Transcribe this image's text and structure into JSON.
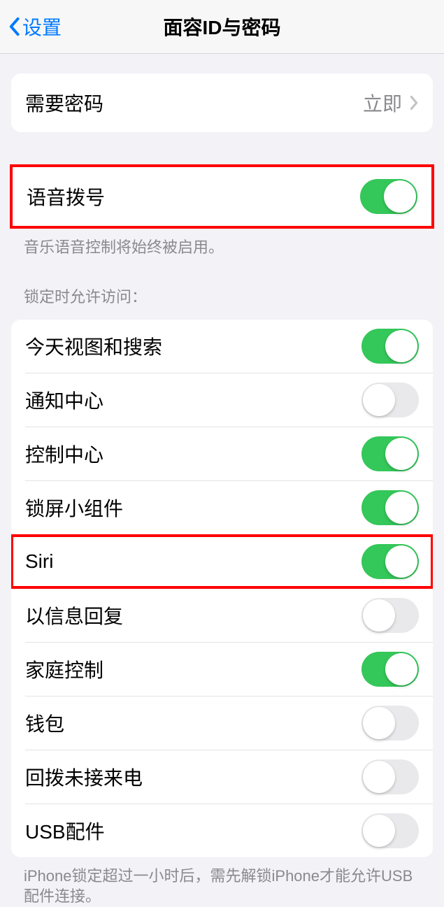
{
  "nav": {
    "back_label": "设置",
    "title": "面容ID与密码"
  },
  "passcode": {
    "label": "需要密码",
    "value": "立即"
  },
  "voice_dial": {
    "label": "语音拨号",
    "on": true,
    "footer": "音乐语音控制将始终被启用。"
  },
  "lock_access": {
    "header": "锁定时允许访问：",
    "items": [
      {
        "label": "今天视图和搜索",
        "on": true,
        "highlighted": false
      },
      {
        "label": "通知中心",
        "on": false,
        "highlighted": false
      },
      {
        "label": "控制中心",
        "on": true,
        "highlighted": false
      },
      {
        "label": "锁屏小组件",
        "on": true,
        "highlighted": false
      },
      {
        "label": "Siri",
        "on": true,
        "highlighted": true
      },
      {
        "label": "以信息回复",
        "on": false,
        "highlighted": false
      },
      {
        "label": "家庭控制",
        "on": true,
        "highlighted": false
      },
      {
        "label": "钱包",
        "on": false,
        "highlighted": false
      },
      {
        "label": "回拨未接来电",
        "on": false,
        "highlighted": false
      },
      {
        "label": "USB配件",
        "on": false,
        "highlighted": false
      }
    ],
    "footer": "iPhone锁定超过一小时后，需先解锁iPhone才能允许USB配件连接。"
  }
}
